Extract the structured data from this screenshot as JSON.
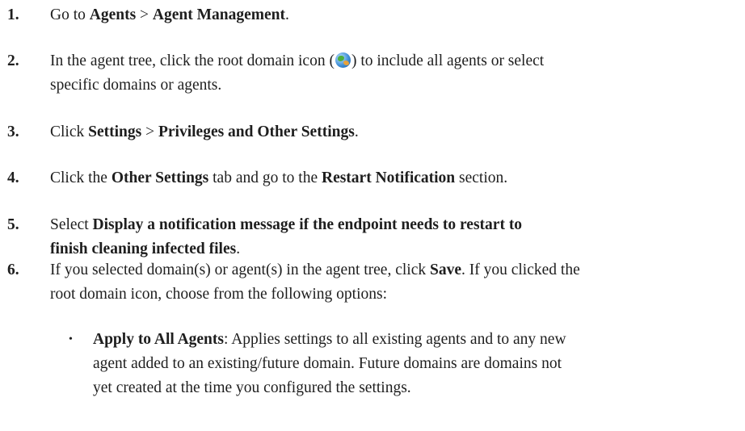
{
  "steps": [
    {
      "num": "1.",
      "t1": "Go to ",
      "b1": "Agents",
      "t2": " > ",
      "b2": "Agent Management",
      "t3": "."
    },
    {
      "num": "2.",
      "t1": "In the agent tree, click the root domain icon (",
      "icon": "root-domain-globe-icon",
      "t2": ") to include all agents or select",
      "t3": "specific domains or agents."
    },
    {
      "num": "3.",
      "t1": "Click ",
      "b1": "Settings",
      "t2": " > ",
      "b2": "Privileges and Other Settings",
      "t3": "."
    },
    {
      "num": "4.",
      "t1": "Click the ",
      "b1": "Other Settings",
      "t2": " tab and go to the ",
      "b2": "Restart Notification",
      "t3": " section."
    },
    {
      "num": "5.",
      "t1": "Select ",
      "b1": "Display a notification message if the endpoint needs to restart to",
      "b2": "finish cleaning infected files",
      "t2": "."
    },
    {
      "num": "6.",
      "t1": "If you selected domain(s) or agent(s) in the agent tree, click ",
      "b1": "Save",
      "t2": ". If you clicked the",
      "t3": "root domain icon, choose from the following options:"
    }
  ],
  "bullet": {
    "symbol": "•",
    "b1": "Apply to All Agents",
    "line1": ": Applies settings to all existing agents and to any new",
    "line2": "agent added to an existing/future domain. Future domains are domains not",
    "line3": "yet created at the time you configured the settings."
  }
}
